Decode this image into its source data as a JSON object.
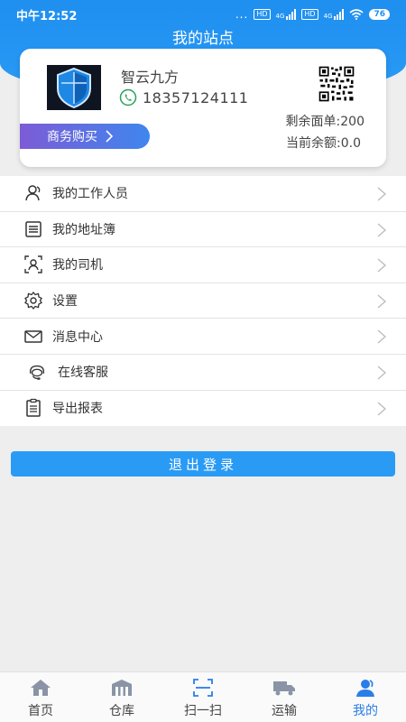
{
  "status_bar": {
    "time": "中午12:52",
    "dots": "...",
    "hd1": "HD",
    "net1": "4G",
    "hd2": "HD",
    "net2": "4G",
    "battery": "76"
  },
  "header": {
    "title": "我的站点"
  },
  "profile": {
    "company_name": "智云九方",
    "phone": "18357124111",
    "buy_button": "商务购买",
    "remaining_label": "剩余面单:200",
    "balance_label": "当前余额:0.0"
  },
  "menu": [
    {
      "label": "我的工作人员",
      "icon": "staff-icon"
    },
    {
      "label": "我的地址簿",
      "icon": "address-book-icon"
    },
    {
      "label": "我的司机",
      "icon": "driver-icon"
    },
    {
      "label": "设置",
      "icon": "gear-icon"
    },
    {
      "label": "消息中心",
      "icon": "mail-icon"
    },
    {
      "label": "在线客服",
      "icon": "headset-icon"
    },
    {
      "label": "导出报表",
      "icon": "report-icon"
    }
  ],
  "logout": "退出登录",
  "tabs": [
    {
      "label": "首页",
      "icon": "home-icon"
    },
    {
      "label": "仓库",
      "icon": "warehouse-icon"
    },
    {
      "label": "扫一扫",
      "icon": "scan-icon"
    },
    {
      "label": "运输",
      "icon": "truck-icon"
    },
    {
      "label": "我的",
      "icon": "user-icon",
      "active": true
    }
  ],
  "colors": {
    "primary": "#2a9bf5",
    "active_tab": "#2a7ee8",
    "buy_gradient_start": "#7c5cd6"
  }
}
